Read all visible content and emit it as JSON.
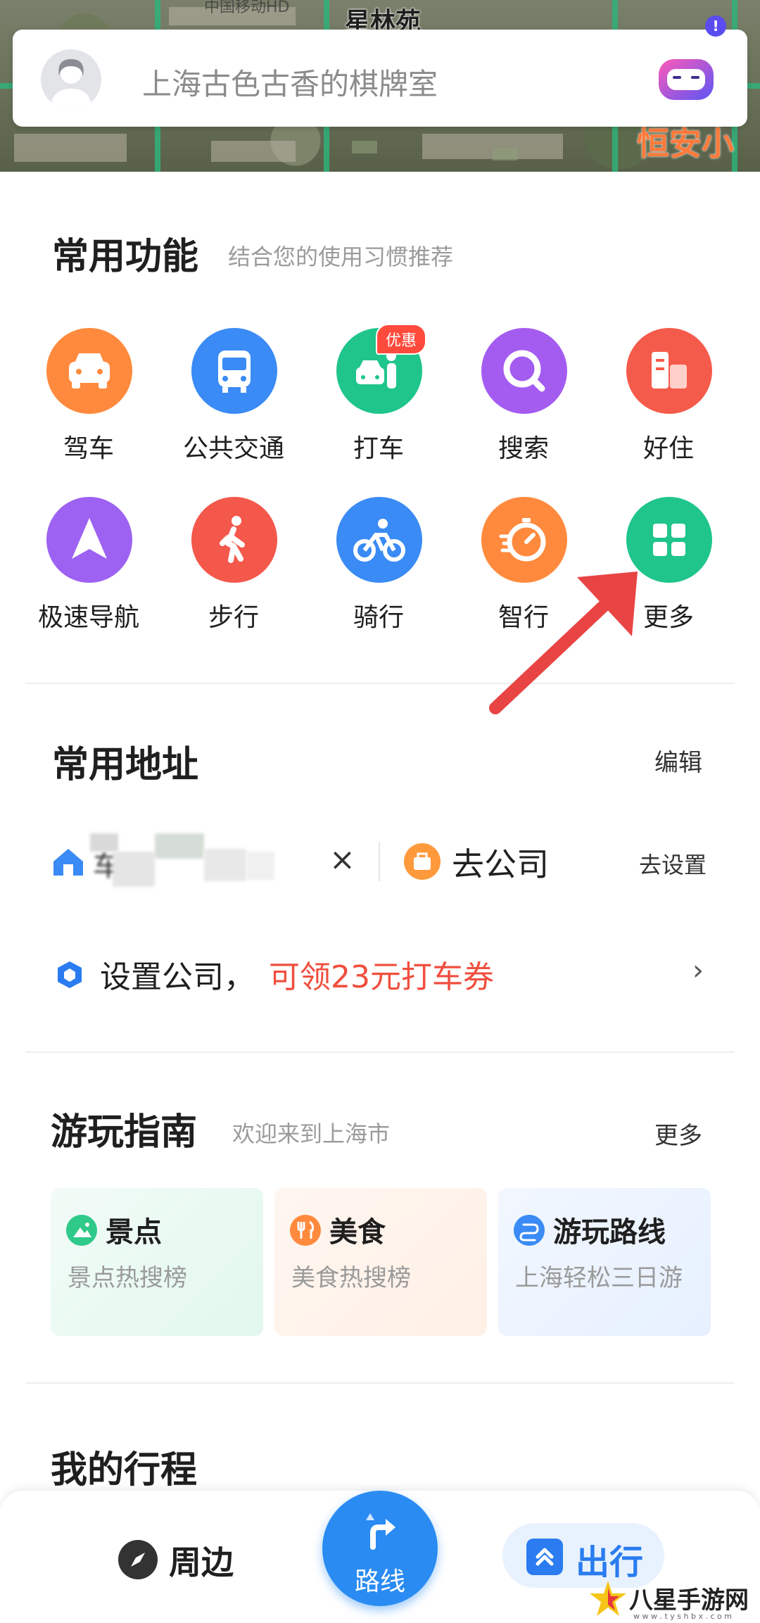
{
  "map": {
    "carrier": "中国移动HD",
    "street_label": "星林苑",
    "place_label": "恒安小区"
  },
  "search": {
    "placeholder": "上海古色古香的棋牌室",
    "robot_badge": "!"
  },
  "common_functions": {
    "title": "常用功能",
    "subtitle": "结合您的使用习惯推荐",
    "items": [
      {
        "label": "驾车",
        "icon": "car-icon",
        "color": "#ff8a3d"
      },
      {
        "label": "公共交通",
        "icon": "bus-icon",
        "color": "#3a8bf5"
      },
      {
        "label": "打车",
        "icon": "taxi-icon",
        "color": "#1fc58a",
        "badge": "优惠"
      },
      {
        "label": "搜索",
        "icon": "search-icon",
        "color": "#a45cf0"
      },
      {
        "label": "好住",
        "icon": "hotel-icon",
        "color": "#f55b4a"
      },
      {
        "label": "极速导航",
        "icon": "navigation-icon",
        "color": "#9d62f2"
      },
      {
        "label": "步行",
        "icon": "walk-icon",
        "color": "#f3584b"
      },
      {
        "label": "骑行",
        "icon": "bike-icon",
        "color": "#3a8bf5"
      },
      {
        "label": "智行",
        "icon": "timer-icon",
        "color": "#ff8a3d"
      },
      {
        "label": "更多",
        "icon": "grid-icon",
        "color": "#1fc58a"
      }
    ]
  },
  "addresses": {
    "title": "常用地址",
    "edit": "编辑",
    "home_blurred": "车",
    "company": "去公司",
    "company_action": "去设置",
    "promo_prefix": "设置公司，",
    "promo_highlight": "可领23元打车券"
  },
  "guide": {
    "title": "游玩指南",
    "subtitle": "欢迎来到上海市",
    "more": "更多",
    "cards": [
      {
        "title": "景点",
        "subtitle": "景点热搜榜",
        "color": "#2fc98a"
      },
      {
        "title": "美食",
        "subtitle": "美食热搜榜",
        "color": "#ff8a3d"
      },
      {
        "title": "游玩路线",
        "subtitle": "上海轻松三日游",
        "color": "#3a8bf5"
      }
    ]
  },
  "trips": {
    "title": "我的行程"
  },
  "bottom_nav": {
    "nearby": "周边",
    "route": "路线",
    "go": "出行"
  },
  "watermark": {
    "text": "八星手游网",
    "url": "w w w . t y s h b x . c o m"
  }
}
